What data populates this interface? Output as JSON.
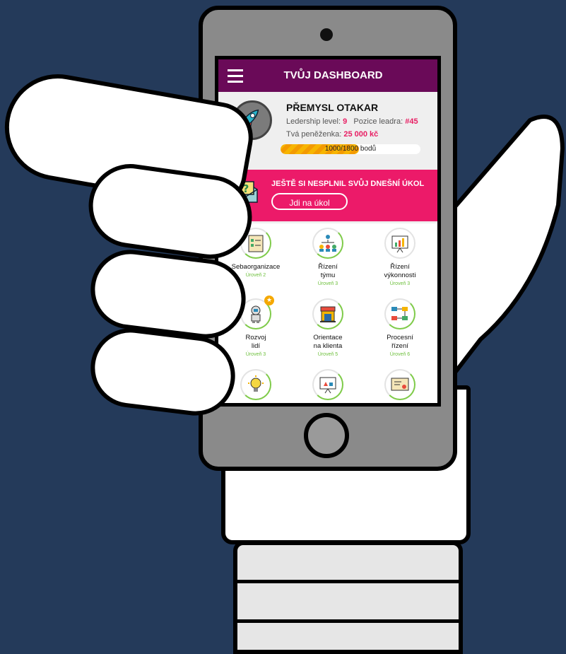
{
  "header": {
    "title": "TVŮJ DASHBOARD"
  },
  "profile": {
    "name": "PŘEMYSL OTAKAR",
    "level_label": "Ledership level:",
    "level_value": "9",
    "rank_label": "Pozice leadra:",
    "rank_value": "#45",
    "wallet_label": "Tvá peněženka:",
    "wallet_value": "25 000 kč",
    "progress_text": "1000/1800 bodů",
    "progress_fraction": 0.56
  },
  "task": {
    "title": "JEŠTĚ SI NESPLNIL SVŮJ DNEŠNÍ ÚKOL",
    "button": "Jdi na úkol",
    "icon": "question-envelope-icon"
  },
  "skills": [
    {
      "label": "Sebaorganizace",
      "level": "Úroveň 2",
      "icon": "checklist-icon"
    },
    {
      "label": "Řízení\ntýmu",
      "level": "Úroveň 3",
      "icon": "team-hierarchy-icon"
    },
    {
      "label": "Řízení\nvýkonnosti",
      "level": "Úroveň 3",
      "icon": "performance-chart-icon"
    },
    {
      "label": "Rozvoj\nlidí",
      "level": "Úroveň 3",
      "icon": "astronaut-icon"
    },
    {
      "label": "Orientace\nna klienta",
      "level": "Úroveň 5",
      "icon": "shop-icon"
    },
    {
      "label": "Procesní\nřízení",
      "level": "Úroveň 6",
      "icon": "process-flow-icon"
    },
    {
      "label": "",
      "level": "",
      "icon": "lightbulb-icon"
    },
    {
      "label": "",
      "level": "",
      "icon": "presentation-icon"
    },
    {
      "label": "",
      "level": "",
      "icon": "certificate-icon"
    }
  ],
  "colors": {
    "background": "#243a5a",
    "header": "#6a0a58",
    "accent_pink": "#e81e63",
    "task_banner": "#ec1a69",
    "progress": "#f7b500",
    "level_green": "#6cbf3a"
  }
}
